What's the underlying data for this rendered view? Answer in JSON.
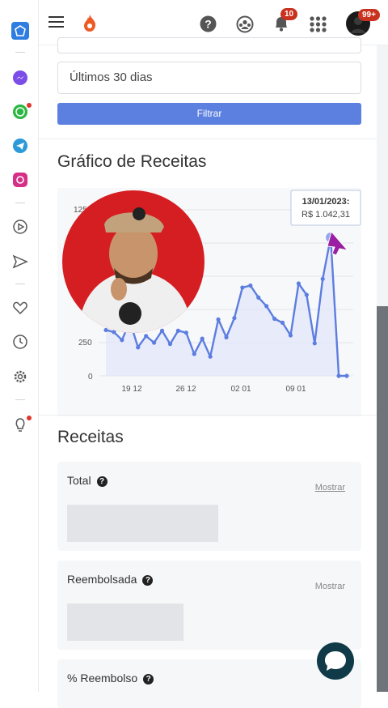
{
  "header": {
    "notification_count": "10",
    "profile_badge": "99+",
    "icons": [
      "menu-icon",
      "fire-logo-icon",
      "help-icon",
      "support-icon",
      "bell-icon",
      "apps-grid-icon",
      "avatar"
    ]
  },
  "sidebar": {
    "items": [
      "home-icon",
      "messenger-icon",
      "whatsapp-icon",
      "telegram-icon",
      "instagram-icon",
      "play-icon",
      "send-icon",
      "heart-icon",
      "clock-icon",
      "gear-icon",
      "lightbulb-icon"
    ]
  },
  "filters": {
    "date_range": "Últimos 30 dias",
    "filter_button": "Filtrar"
  },
  "chart": {
    "title": "Gráfico de Receitas",
    "tooltip_date": "13/01/2023:",
    "tooltip_value": "R$ 1.042,31",
    "y_ticks": [
      "0",
      "250",
      "1250"
    ],
    "x_ticks": [
      "19 12",
      "26 12",
      "02 01",
      "09 01"
    ]
  },
  "chart_data": {
    "type": "area",
    "title": "Gráfico de Receitas",
    "x": [
      "16/12",
      "17/12",
      "18/12",
      "19/12",
      "20/12",
      "21/12",
      "22/12",
      "23/12",
      "24/12",
      "25/12",
      "26/12",
      "27/12",
      "28/12",
      "29/12",
      "30/12",
      "31/12",
      "01/01",
      "02/01",
      "03/01",
      "04/01",
      "05/01",
      "06/01",
      "07/01",
      "08/01",
      "09/01",
      "10/01",
      "11/01",
      "12/01",
      "13/01",
      "14/01",
      "15/01"
    ],
    "series": [
      {
        "values": [
          345,
          330,
          270,
          410,
          215,
          300,
          250,
          340,
          240,
          340,
          325,
          165,
          280,
          145,
          425,
          290,
          435,
          665,
          680,
          590,
          525,
          430,
          400,
          305,
          695,
          610,
          245,
          730,
          1042,
          0,
          0
        ]
      }
    ],
    "ylim": [
      0,
      1250
    ],
    "grid": true,
    "tooltip": {
      "x": "13/01/2023",
      "y": 1042.31
    }
  },
  "revenue": {
    "title": "Receitas",
    "cards": [
      {
        "label": "Total",
        "action": "Mostrar"
      },
      {
        "label": "Reembolsada",
        "action": "Mostrar"
      },
      {
        "label": "% Reembolso"
      }
    ]
  },
  "colors": {
    "accent": "#5b80e0",
    "line": "#5d7de0",
    "badge": "#c8321f",
    "chat": "#103a48"
  }
}
